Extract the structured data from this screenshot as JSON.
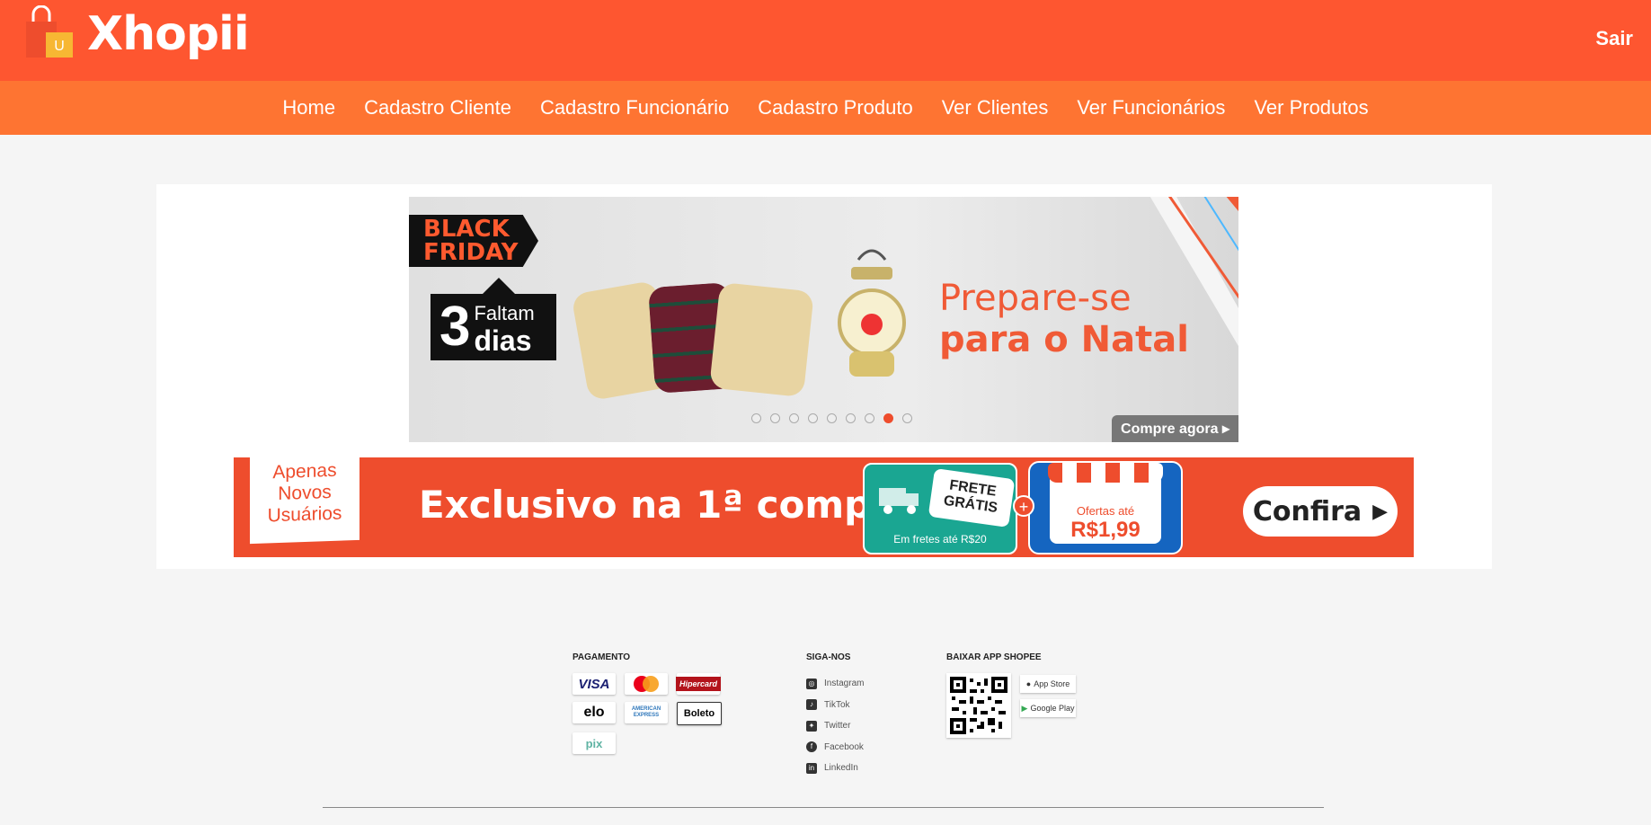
{
  "header": {
    "brand": "Xhopii",
    "logo_letter": "U",
    "logout_label": "Sair"
  },
  "nav": {
    "items": [
      "Home",
      "Cadastro Cliente",
      "Cadastro Funcionário",
      "Cadastro Produto",
      "Ver Clientes",
      "Ver Funcionários",
      "Ver Produtos"
    ]
  },
  "carousel": {
    "tag_line1": "BLACK",
    "tag_line2": "FRIDAY",
    "days_number": "3",
    "days_label_top": "Faltam",
    "days_label_bottom": "dias",
    "headline_line1": "Prepare-se",
    "headline_line2": "para o Natal",
    "cta": "Compre agora ▸",
    "slides_total": 9,
    "active_slide": 8
  },
  "promo": {
    "badge_line1": "Apenas",
    "badge_line2": "Novos",
    "badge_line3": "Usuários",
    "headline": "Exclusivo na 1ª compra",
    "frete_line1": "FRETE",
    "frete_line2": "GRÁTIS",
    "frete_sub": "Em fretes até R$20",
    "plus": "+",
    "ofertas_label": "Ofertas até",
    "ofertas_price": "R$1,99",
    "cta": "Confira"
  },
  "footer": {
    "payment_title": "PAGAMENTO",
    "payments": [
      "VISA",
      "Mastercard",
      "Hipercard",
      "elo",
      "AMERICAN EXPRESS",
      "Boleto",
      "pix"
    ],
    "social_title": "SIGA-NOS",
    "social": [
      "Instagram",
      "TikTok",
      "Twitter",
      "Facebook",
      "LinkedIn"
    ],
    "app_title": "BAIXAR APP SHOPEE",
    "stores": [
      "App Store",
      "Google Play"
    ]
  },
  "colors": {
    "header": "#fe5630",
    "nav": "#fe7432",
    "accent": "#ee4d2d"
  }
}
